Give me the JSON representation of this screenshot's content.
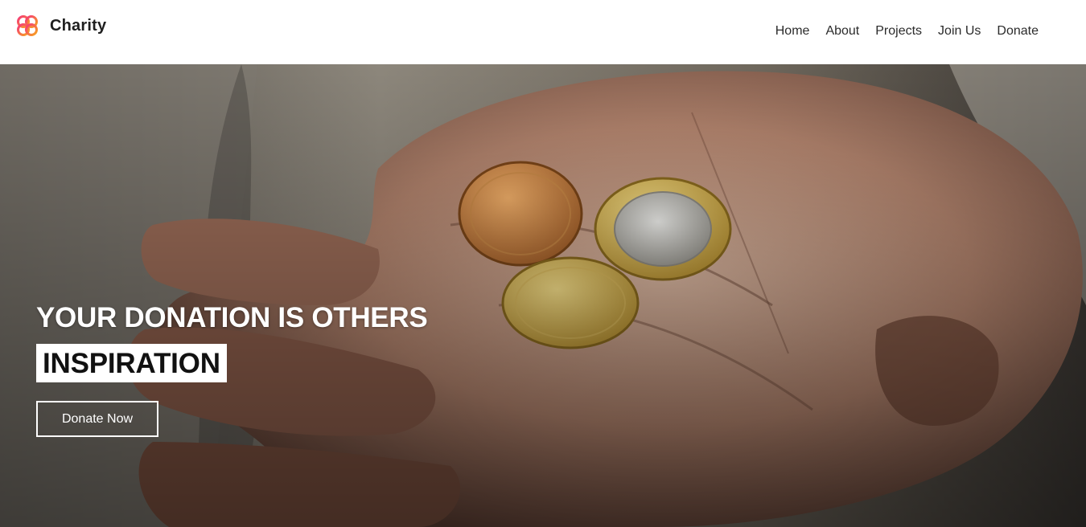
{
  "brand": {
    "name": "Charity",
    "logo_icon": "heart-knot-logo-icon",
    "logo_colors": [
      "#f5367a",
      "#f7a41d"
    ]
  },
  "nav": {
    "items": [
      {
        "label": "Home"
      },
      {
        "label": "About"
      },
      {
        "label": "Projects"
      },
      {
        "label": "Join Us"
      },
      {
        "label": "Donate"
      }
    ]
  },
  "hero": {
    "headline": "YOUR DONATION IS OTHERS",
    "highlight": "INSPIRATION",
    "cta_label": "Donate Now",
    "background_image": "open-hand-holding-coins-photo"
  },
  "colors": {
    "nav_bg": "#ffffff",
    "text": "#2b2b2b",
    "hero_text": "#ffffff",
    "highlight_bg": "#ffffff"
  }
}
